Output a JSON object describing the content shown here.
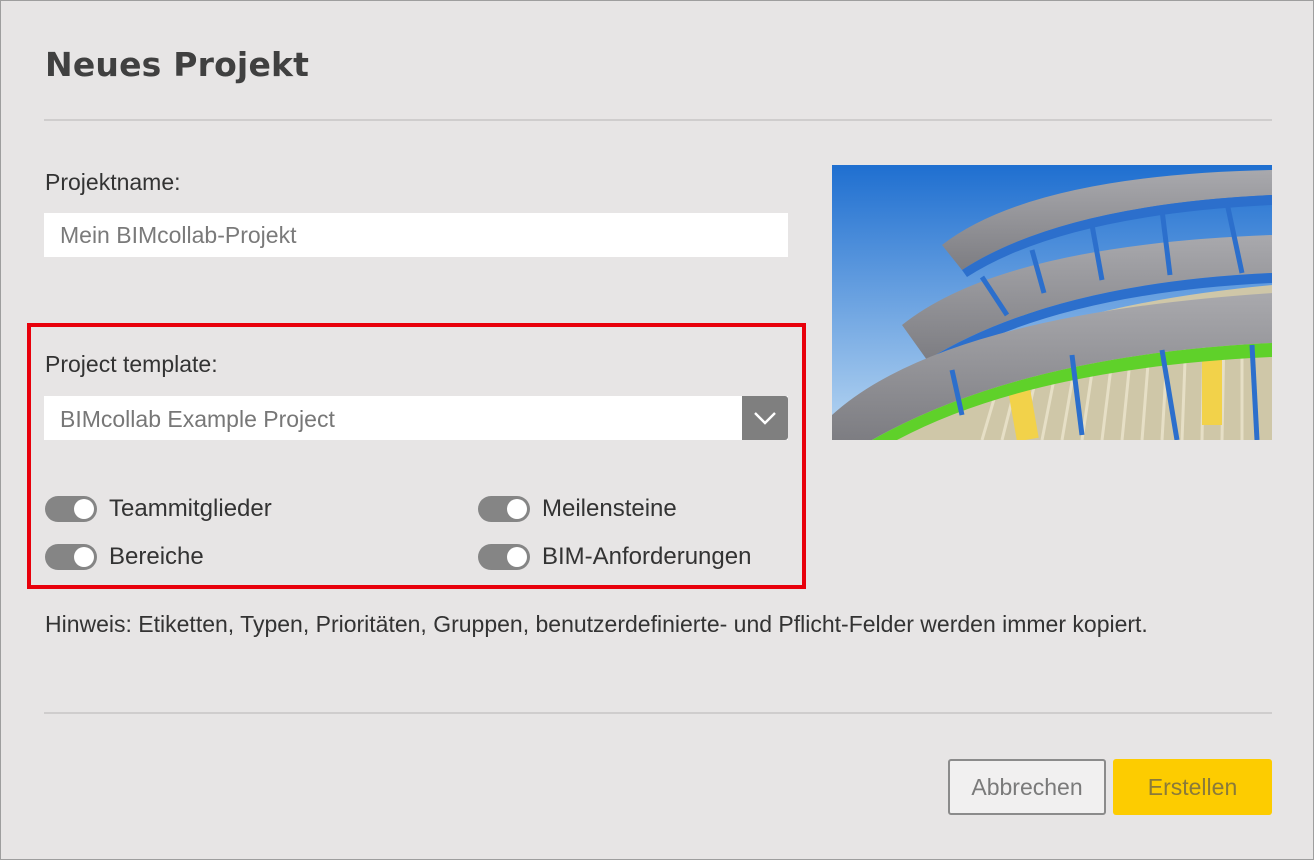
{
  "dialog": {
    "title": "Neues Projekt",
    "project_name": {
      "label": "Projektname:",
      "placeholder": "Mein BIMcollab-Projekt",
      "value": ""
    },
    "template": {
      "label": "Project template:",
      "selected": "BIMcollab Example Project",
      "dropdown_icon": "chevron-down-icon"
    },
    "toggles": [
      {
        "label": "Teammitglieder",
        "on": true
      },
      {
        "label": "Meilensteine",
        "on": true
      },
      {
        "label": "Bereiche",
        "on": true
      },
      {
        "label": "BIM-Anforderungen",
        "on": true
      }
    ],
    "note": "Hinweis: Etiketten, Typen, Prioritäten, Gruppen, benutzerdefinierte- und Pflicht-Felder werden immer kopiert.",
    "buttons": {
      "cancel": "Abbrechen",
      "create": "Erstellen"
    }
  },
  "colors": {
    "background": "#e7e5e5",
    "accent_yellow": "#fdcc00",
    "highlight_red": "#e8000b",
    "toggle_gray": "#858585"
  }
}
